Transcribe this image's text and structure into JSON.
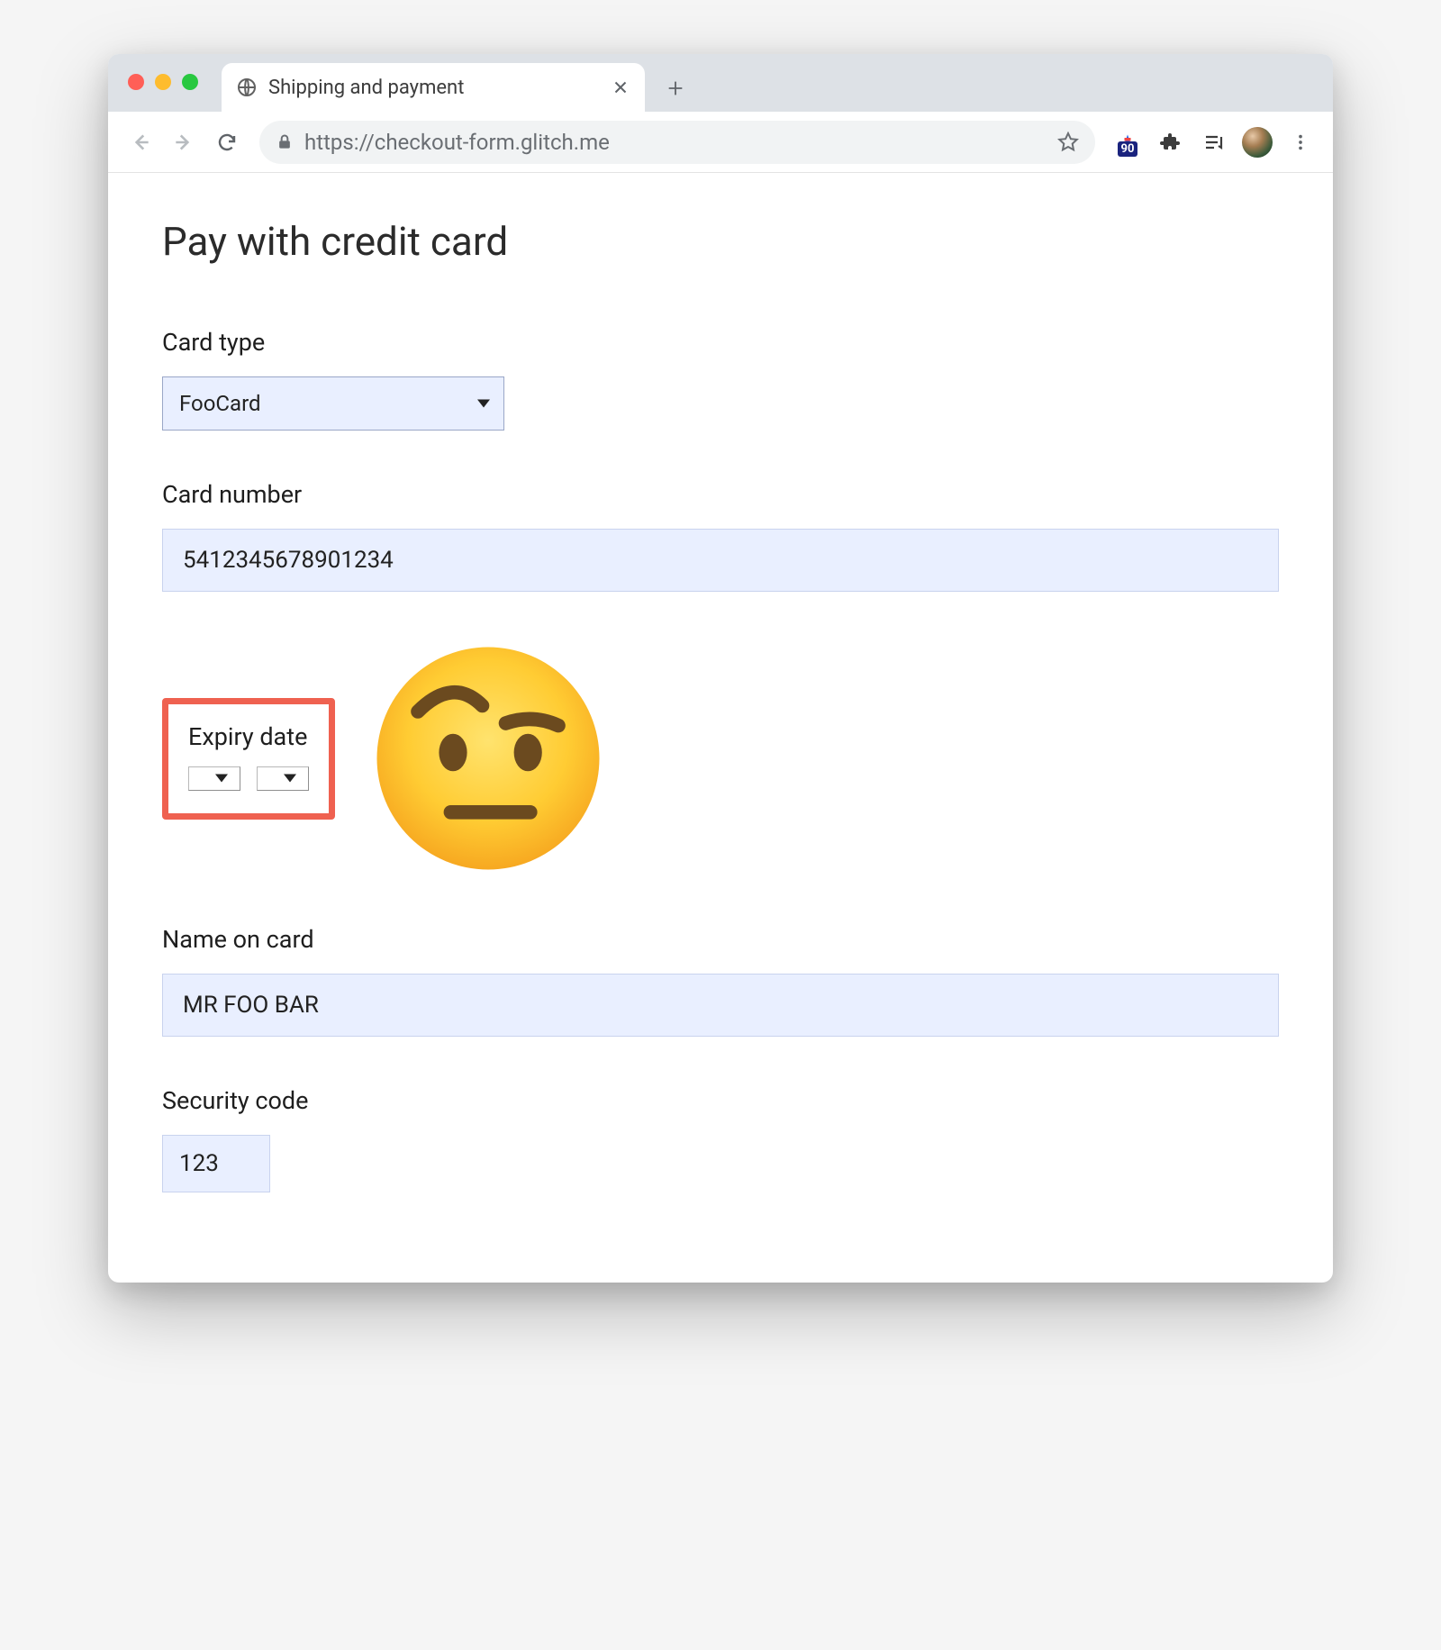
{
  "browser": {
    "tab_title": "Shipping and payment",
    "url": "https://checkout-form.glitch.me",
    "extension_badge": "90"
  },
  "page": {
    "heading": "Pay with credit card",
    "card_type": {
      "label": "Card type",
      "value": "FooCard"
    },
    "card_number": {
      "label": "Card number",
      "value": "5412345678901234"
    },
    "expiry": {
      "label": "Expiry date",
      "month_value": "",
      "year_value": ""
    },
    "name_on_card": {
      "label": "Name on card",
      "value": "MR FOO BAR"
    },
    "security_code": {
      "label": "Security code",
      "value": "123"
    }
  },
  "annotation": {
    "emoji": "raised-eyebrow-face",
    "highlight_color": "#ef6150"
  }
}
